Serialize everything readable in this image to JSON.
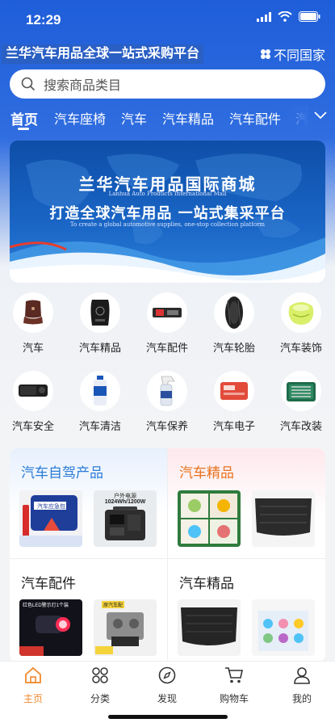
{
  "status": {
    "time": "12:29"
  },
  "header": {
    "title": "兰华汽车用品全球一站式采购平台",
    "country_label": "不同国家"
  },
  "search": {
    "placeholder": "搜索商品类目"
  },
  "tabs": [
    {
      "label": "首页",
      "active": true
    },
    {
      "label": "汽车座椅"
    },
    {
      "label": "汽车"
    },
    {
      "label": "汽车精品"
    },
    {
      "label": "汽车配件"
    },
    {
      "label": "汽"
    }
  ],
  "banner": {
    "title": "兰华汽车用品国际商城",
    "title_en": "Lanhua Auto Products International Mall",
    "subtitle": "打造全球汽车用品 一站式集采平台",
    "subtitle_en": "To create a global automotive supplies, one-stop collection platform",
    "slide_count": 4,
    "current_slide": 1
  },
  "categories": [
    {
      "label": "汽车",
      "icon": "seat-cushion-icon"
    },
    {
      "label": "汽车精品",
      "icon": "floor-mat-icon"
    },
    {
      "label": "汽车配件",
      "icon": "air-filter-icon"
    },
    {
      "label": "汽车轮胎",
      "icon": "tire-icon"
    },
    {
      "label": "汽车装饰",
      "icon": "air-freshener-icon"
    },
    {
      "label": "汽车安全",
      "icon": "dashcam-icon"
    },
    {
      "label": "汽车清洁",
      "icon": "cleaner-bottle-icon"
    },
    {
      "label": "汽车保养",
      "icon": "spray-bottle-icon"
    },
    {
      "label": "汽车电子",
      "icon": "electronic-box-icon"
    },
    {
      "label": "汽车改装",
      "icon": "tool-case-icon"
    }
  ],
  "cards": {
    "c1": {
      "title": "汽车自驾产品",
      "title_color": "#2a7bd6",
      "thumb1_text": "汽车应急包",
      "thumb2_line1": "户外电源",
      "thumb2_line2": "1024Wh/1200W"
    },
    "c2": {
      "title": "汽车精品",
      "title_color": "#e8731f"
    },
    "c3": {
      "title": "汽车配件",
      "thumb1_text": "红色LED警示灯1个装",
      "thumb2_text": "原汽车配"
    },
    "c4": {
      "title": "汽车精品"
    }
  },
  "tabbar": [
    {
      "label": "主页",
      "icon": "home-icon",
      "active": true
    },
    {
      "label": "分类",
      "icon": "category-icon"
    },
    {
      "label": "发现",
      "icon": "compass-icon"
    },
    {
      "label": "购物车",
      "icon": "cart-icon"
    },
    {
      "label": "我的",
      "icon": "user-icon"
    }
  ],
  "colors": {
    "primary": "#2f6de0",
    "active_tab": "#f0892c"
  }
}
